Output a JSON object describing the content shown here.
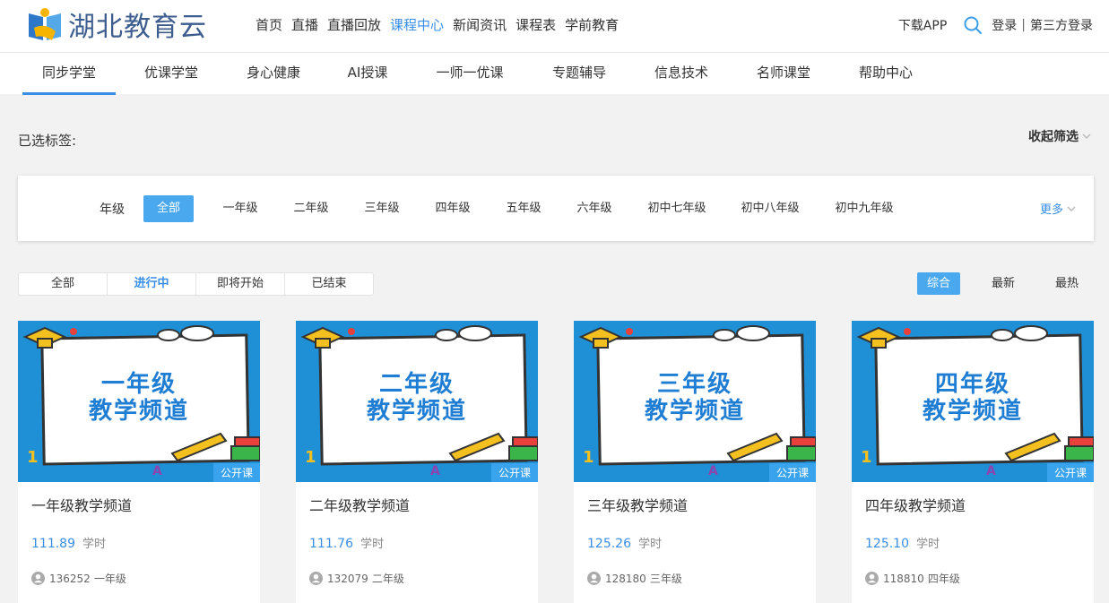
{
  "header": {
    "logo_text": "湖北教育云",
    "nav": [
      "首页",
      "直播",
      "直播回放",
      "课程中心",
      "新闻资讯",
      "课程表",
      "学前教育"
    ],
    "active_nav": 3,
    "download": "下载APP",
    "login": "登录",
    "separator": "|",
    "third_party_login": "第三方登录"
  },
  "subnav": {
    "tabs": [
      "同步学堂",
      "优课学堂",
      "身心健康",
      "AI授课",
      "一师一优课",
      "专题辅导",
      "信息技术",
      "名师课堂",
      "帮助中心"
    ],
    "active": 0
  },
  "filters": {
    "selected_label": "已选标签:",
    "collapse": "收起筛选",
    "grade_label": "年级",
    "grades": [
      "全部",
      "一年级",
      "二年级",
      "三年级",
      "四年级",
      "五年级",
      "六年级",
      "初中七年级",
      "初中八年级",
      "初中九年级"
    ],
    "active_grade": 0,
    "more": "更多"
  },
  "status": {
    "tabs": [
      "全部",
      "进行中",
      "即将开始",
      "已结束"
    ],
    "active": 1
  },
  "sort": {
    "options": [
      "综合",
      "最新",
      "最热"
    ],
    "active": 0
  },
  "cards": [
    {
      "thumb_line1": "一年级",
      "thumb_line2": "教学频道",
      "badge": "公开课",
      "title": "一年级教学频道",
      "hours": "111.89",
      "hours_unit": "学时",
      "views": "136252",
      "grade": "一年级"
    },
    {
      "thumb_line1": "二年级",
      "thumb_line2": "教学频道",
      "badge": "公开课",
      "title": "二年级教学频道",
      "hours": "111.76",
      "hours_unit": "学时",
      "views": "132079",
      "grade": "二年级"
    },
    {
      "thumb_line1": "三年级",
      "thumb_line2": "教学频道",
      "badge": "公开课",
      "title": "三年级教学频道",
      "hours": "125.26",
      "hours_unit": "学时",
      "views": "128180",
      "grade": "三年级"
    },
    {
      "thumb_line1": "四年级",
      "thumb_line2": "教学频道",
      "badge": "公开课",
      "title": "四年级教学频道",
      "hours": "125.10",
      "hours_unit": "学时",
      "views": "118810",
      "grade": "四年级"
    }
  ],
  "colors": {
    "accent": "#3a8ee6",
    "active_bg": "#4aa8ef",
    "logo": "#3d5d8f",
    "thumb_bg": "#1f8fd6"
  },
  "icons": {
    "search": "search-icon",
    "user": "user-icon",
    "chevron": "chevron-down-icon"
  }
}
